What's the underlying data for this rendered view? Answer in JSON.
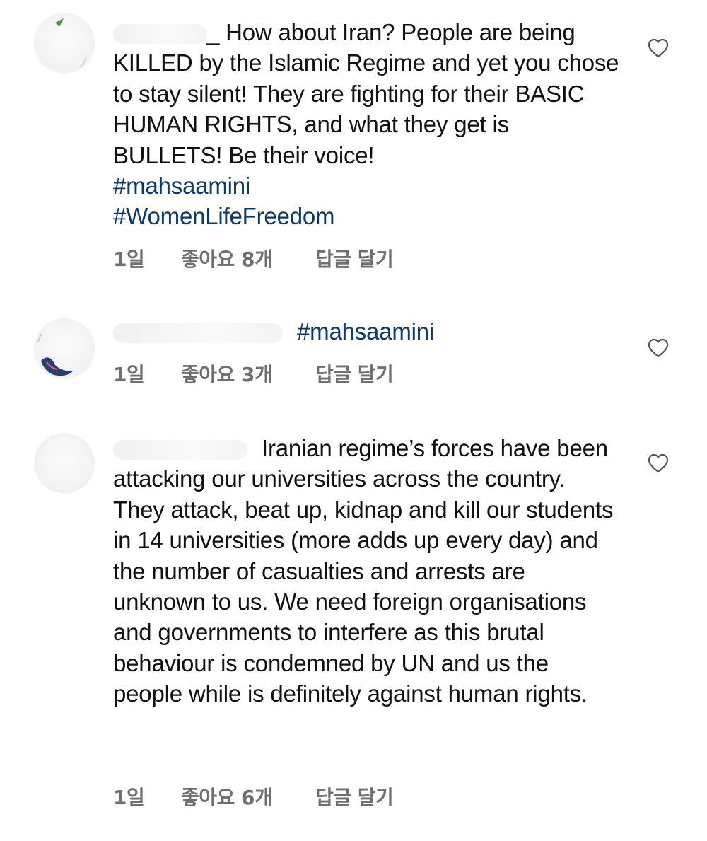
{
  "comments": [
    {
      "username_suffix": "_",
      "text": "How about Iran? People are being KILLED by the Islamic Regime and yet you chose to stay silent! They are fighting for their BASIC HUMAN RIGHTS, and what they get is BULLETS! Be their voice!",
      "hashtags": [
        "#mahsaamini",
        "#WomenLifeFreedom"
      ],
      "time": "1일",
      "likes": "좋아요 8개",
      "reply": "답글 달기"
    },
    {
      "text": "#mahsaamini",
      "time": "1일",
      "likes": "좋아요 3개",
      "reply": "답글 달기"
    },
    {
      "text": "Iranian regime’s forces have been attacking our universities across the country. They attack, beat up, kidnap and kill our students in 14 universities (more adds up every day) and the number of casualties and arrests are unknown to us. We need foreign organisations and governments to interfere as this brutal behaviour is condemned by UN and us the people while is definitely against human rights.",
      "time": "1일",
      "likes": "좋아요 6개",
      "reply": "답글 달기"
    }
  ],
  "icons": {
    "like": "heart-outline-icon",
    "avatar": "user-avatar-icon"
  },
  "colors": {
    "hashtag": "#0b3a6e",
    "meta": "#6f6f6f",
    "text": "#111111"
  }
}
